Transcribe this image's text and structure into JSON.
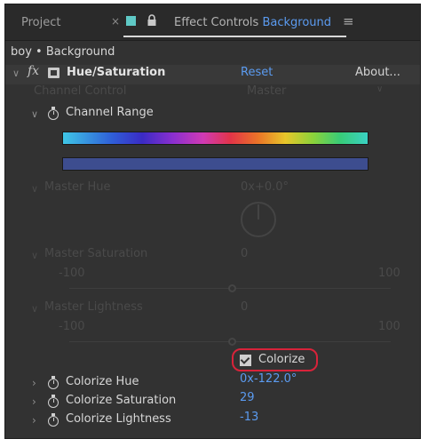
{
  "tabs": {
    "project_label": "Project",
    "close_glyph": "×",
    "effect_controls_prefix": "Effect Controls",
    "effect_controls_layer": "Background",
    "menu_glyph": "≡"
  },
  "comp_path": "boy • Background",
  "effect": {
    "fx_glyph": "fx",
    "name": "Hue/Saturation",
    "reset_label": "Reset",
    "about_label": "About..."
  },
  "channel_control": {
    "label": "Channel Control",
    "value": "Master"
  },
  "channel_range": {
    "label": "Channel Range"
  },
  "master_hue": {
    "label": "Master Hue",
    "value": "0x+0.0°"
  },
  "master_saturation": {
    "label": "Master Saturation",
    "value": "0",
    "min": "-100",
    "max": "100"
  },
  "master_lightness": {
    "label": "Master Lightness",
    "value": "0",
    "min": "-100",
    "max": "100"
  },
  "colorize": {
    "label": "Colorize",
    "checked": true
  },
  "colorize_hue": {
    "label": "Colorize Hue",
    "value": "0x-122.0°"
  },
  "colorize_saturation": {
    "label": "Colorize Saturation",
    "value": "29"
  },
  "colorize_lightness": {
    "label": "Colorize Lightness",
    "value": "-13"
  },
  "colors": {
    "accent": "#5b9bf0",
    "highlight": "#d8233a",
    "panel": "#323232",
    "tab_swatch": "#5fc9c6"
  },
  "icons": [
    "close-icon",
    "label-color-swatch",
    "lock-icon",
    "panel-menu-icon",
    "chevron-icon",
    "fx-toggle-icon",
    "effect-badge-icon",
    "stopwatch-icon",
    "checkbox-icon"
  ]
}
